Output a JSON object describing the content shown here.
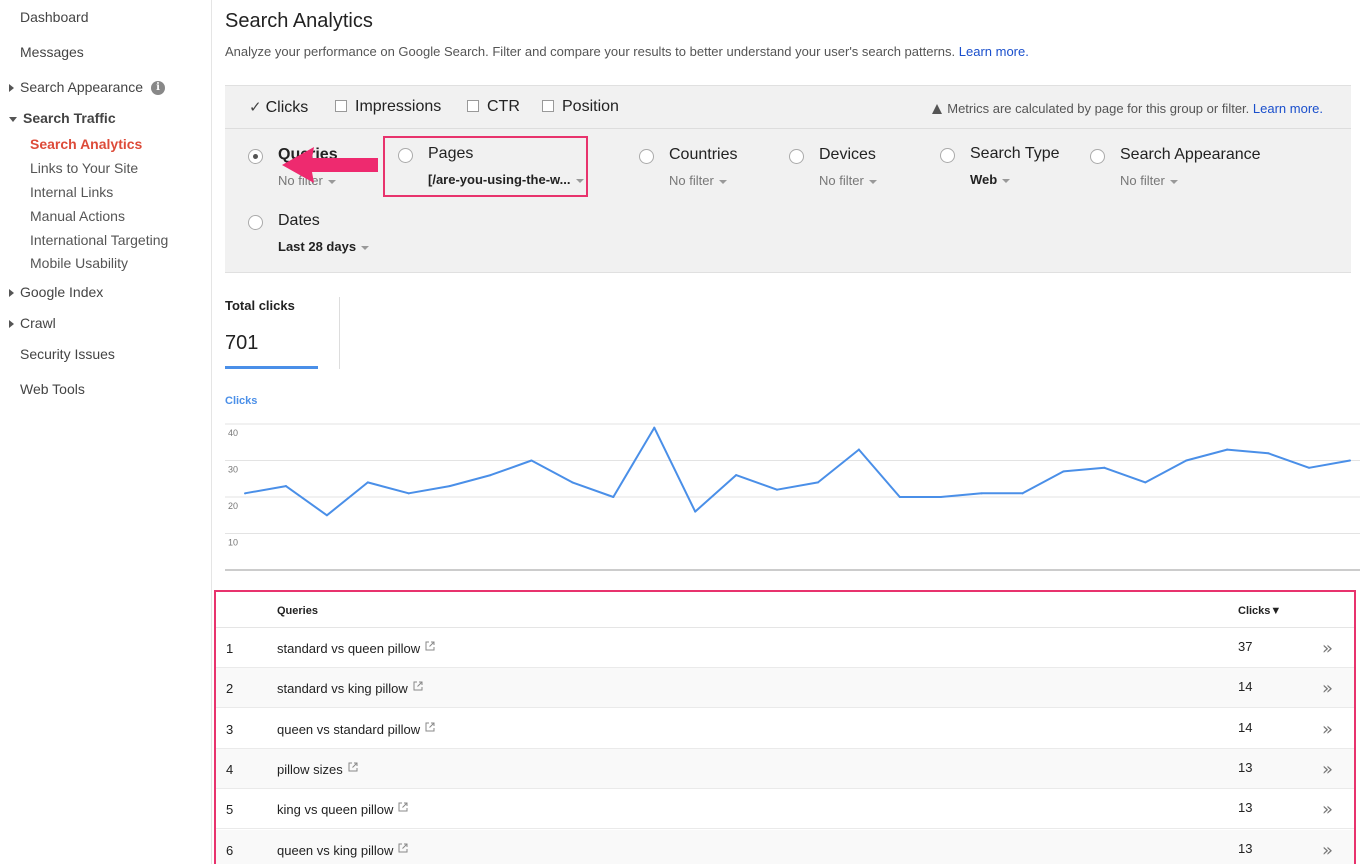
{
  "sidebar": {
    "dashboard": "Dashboard",
    "messages": "Messages",
    "search_appearance": "Search Appearance",
    "search_traffic": "Search Traffic",
    "search_traffic_items": [
      "Search Analytics",
      "Links to Your Site",
      "Internal Links",
      "Manual Actions",
      "International Targeting",
      "Mobile Usability"
    ],
    "google_index": "Google Index",
    "crawl": "Crawl",
    "security_issues": "Security Issues",
    "web_tools": "Web Tools"
  },
  "header": {
    "title": "Search Analytics",
    "description": "Analyze your performance on Google Search. Filter and compare your results to better understand your user's search patterns.",
    "learn_more": "Learn more."
  },
  "metrics": {
    "clicks": "Clicks",
    "impressions": "Impressions",
    "ctr": "CTR",
    "position": "Position",
    "note": "Metrics are calculated by page for this group or filter.",
    "note_link": "Learn more."
  },
  "groups": {
    "queries": {
      "label": "Queries",
      "filter": "No filter"
    },
    "pages": {
      "label": "Pages",
      "filter": "[/are-you-using-the-w..."
    },
    "countries": {
      "label": "Countries",
      "filter": "No filter"
    },
    "devices": {
      "label": "Devices",
      "filter": "No filter"
    },
    "search_type": {
      "label": "Search Type",
      "filter": "Web"
    },
    "search_appearance": {
      "label": "Search Appearance",
      "filter": "No filter"
    },
    "dates": {
      "label": "Dates",
      "filter": "Last 28 days"
    }
  },
  "summary": {
    "label": "Total clicks",
    "value": "701"
  },
  "chart_data": {
    "type": "line",
    "series": [
      {
        "name": "Clicks",
        "color": "#4a8fe8",
        "values": [
          21,
          23,
          15,
          24,
          21,
          23,
          26,
          30,
          24,
          20,
          39,
          16,
          26,
          22,
          24,
          33,
          20,
          20,
          21,
          21,
          27,
          28,
          24,
          30,
          33,
          32,
          28,
          30
        ]
      }
    ],
    "y_ticks": [
      "40",
      "30",
      "20",
      "10"
    ],
    "ylim": [
      0,
      40
    ],
    "grid": true
  },
  "table": {
    "col_query": "Queries",
    "col_clicks": "Clicks▼",
    "rows": [
      {
        "num": "1",
        "query": "standard vs queen pillow",
        "clicks": "37"
      },
      {
        "num": "2",
        "query": "standard vs king pillow",
        "clicks": "14"
      },
      {
        "num": "3",
        "query": "queen vs standard pillow",
        "clicks": "14"
      },
      {
        "num": "4",
        "query": "pillow sizes",
        "clicks": "13"
      },
      {
        "num": "5",
        "query": "king vs queen pillow",
        "clicks": "13"
      },
      {
        "num": "6",
        "query": "queen vs king pillow",
        "clicks": "13"
      }
    ],
    "more_glyph": "»"
  },
  "colors": {
    "accent": "#4a8fe8",
    "active_nav": "#dd4b39",
    "highlight": "#e8336d",
    "link": "#1a4fcc"
  }
}
